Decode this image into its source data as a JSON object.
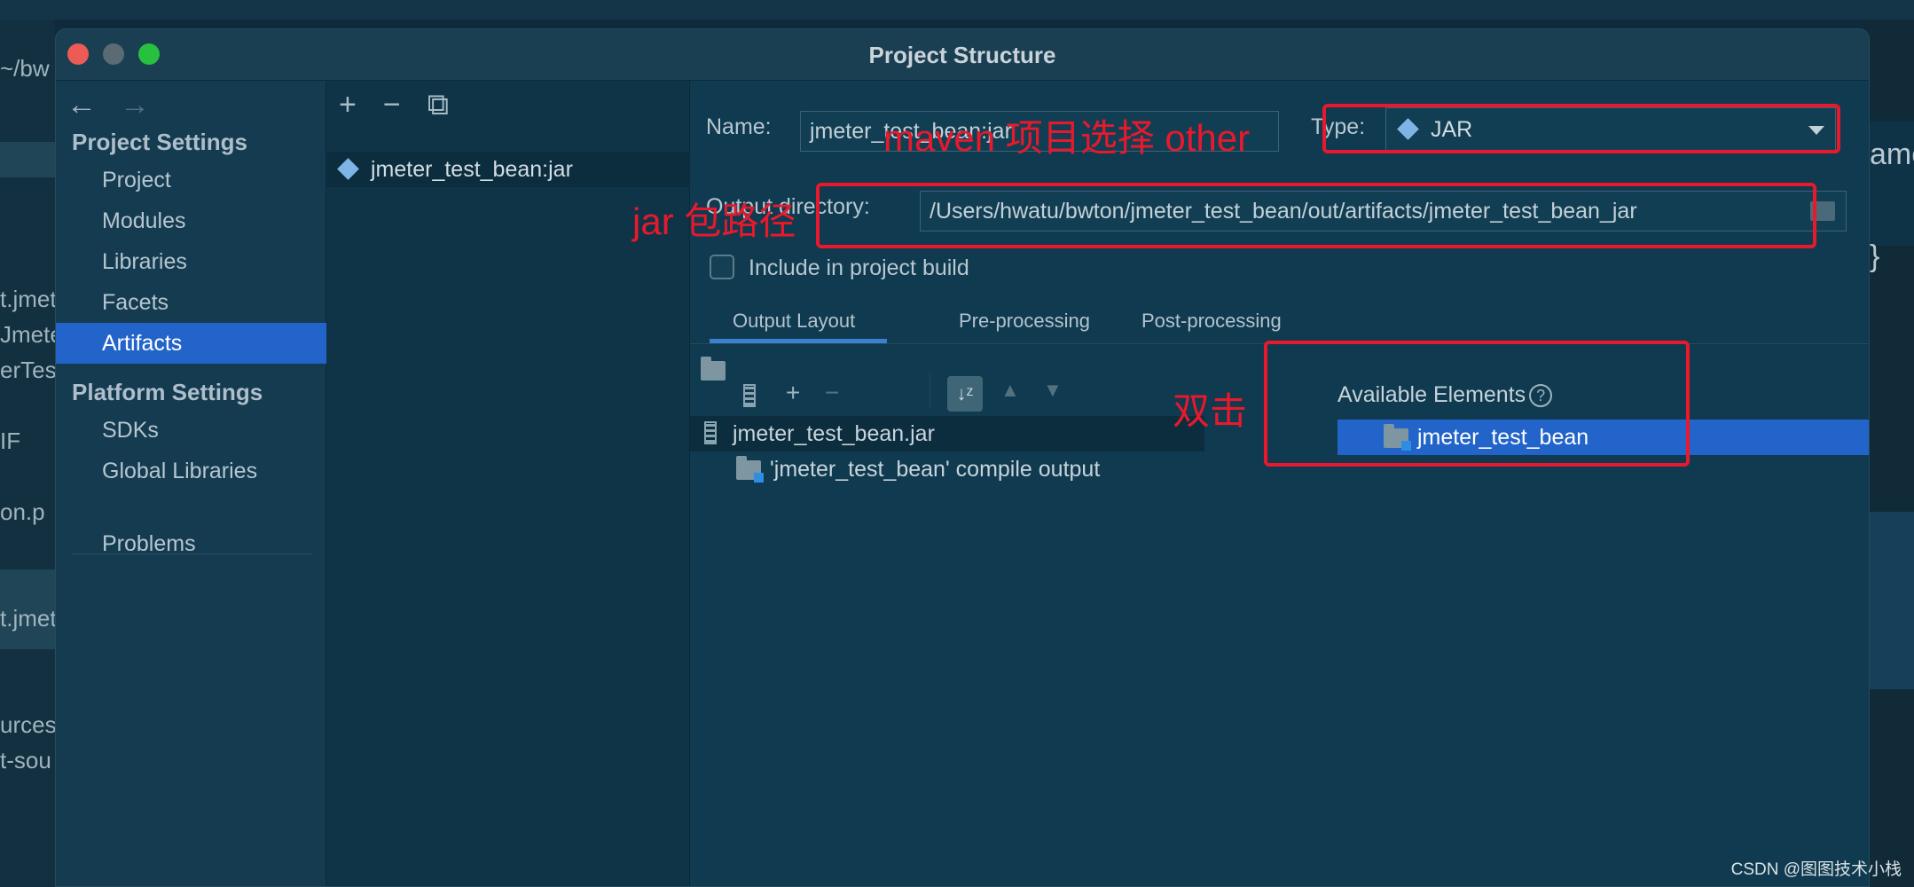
{
  "window": {
    "title": "Project Structure",
    "controls": {
      "close_color": "#ec5b56",
      "minimize_color": "#5b6b73",
      "maximize_color": "#27c13f"
    }
  },
  "background": {
    "fragments_left": [
      "~/bw",
      "t.jmet",
      "Jmete",
      "erTes",
      "IF",
      "on.p",
      "t.jmet",
      "urces",
      "t-sou"
    ],
    "fragments_right": [
      "ame",
      "}"
    ]
  },
  "sidebar": {
    "back_icon": "←",
    "forward_icon": "→",
    "project_settings_title": "Project Settings",
    "project_items": [
      "Project",
      "Modules",
      "Libraries",
      "Facets",
      "Artifacts"
    ],
    "platform_settings_title": "Platform Settings",
    "platform_items": [
      "SDKs",
      "Global Libraries"
    ],
    "problems": "Problems",
    "selected": "Artifacts"
  },
  "artifacts_list": {
    "toolbar": {
      "add": "+",
      "remove": "−",
      "copy": "⧉"
    },
    "items": [
      "jmeter_test_bean:jar"
    ]
  },
  "detail": {
    "name_label": "Name:",
    "name_value": "jmeter_test_bean:jar",
    "type_label": "Type:",
    "type_value": "JAR",
    "output_dir_label": "Output directory:",
    "output_dir_value": "/Users/hwatu/bwton/jmeter_test_bean/out/artifacts/jmeter_test_bean_jar",
    "include_label": "Include in project build",
    "include_checked": false,
    "tabs": [
      "Output Layout",
      "Pre-processing",
      "Post-processing"
    ],
    "active_tab": "Output Layout",
    "layout_tree": {
      "root": "jmeter_test_bean.jar",
      "children": [
        "'jmeter_test_bean' compile output"
      ]
    },
    "available": {
      "title": "Available Elements",
      "help": "?",
      "items": [
        "jmeter_test_bean"
      ]
    }
  },
  "annotations": {
    "type_note": "maven 项目选择 other",
    "path_note": "jar 包路径",
    "double_click_note": "双击",
    "color": "#e8192c"
  },
  "watermark": "CSDN @图图技术小栈"
}
